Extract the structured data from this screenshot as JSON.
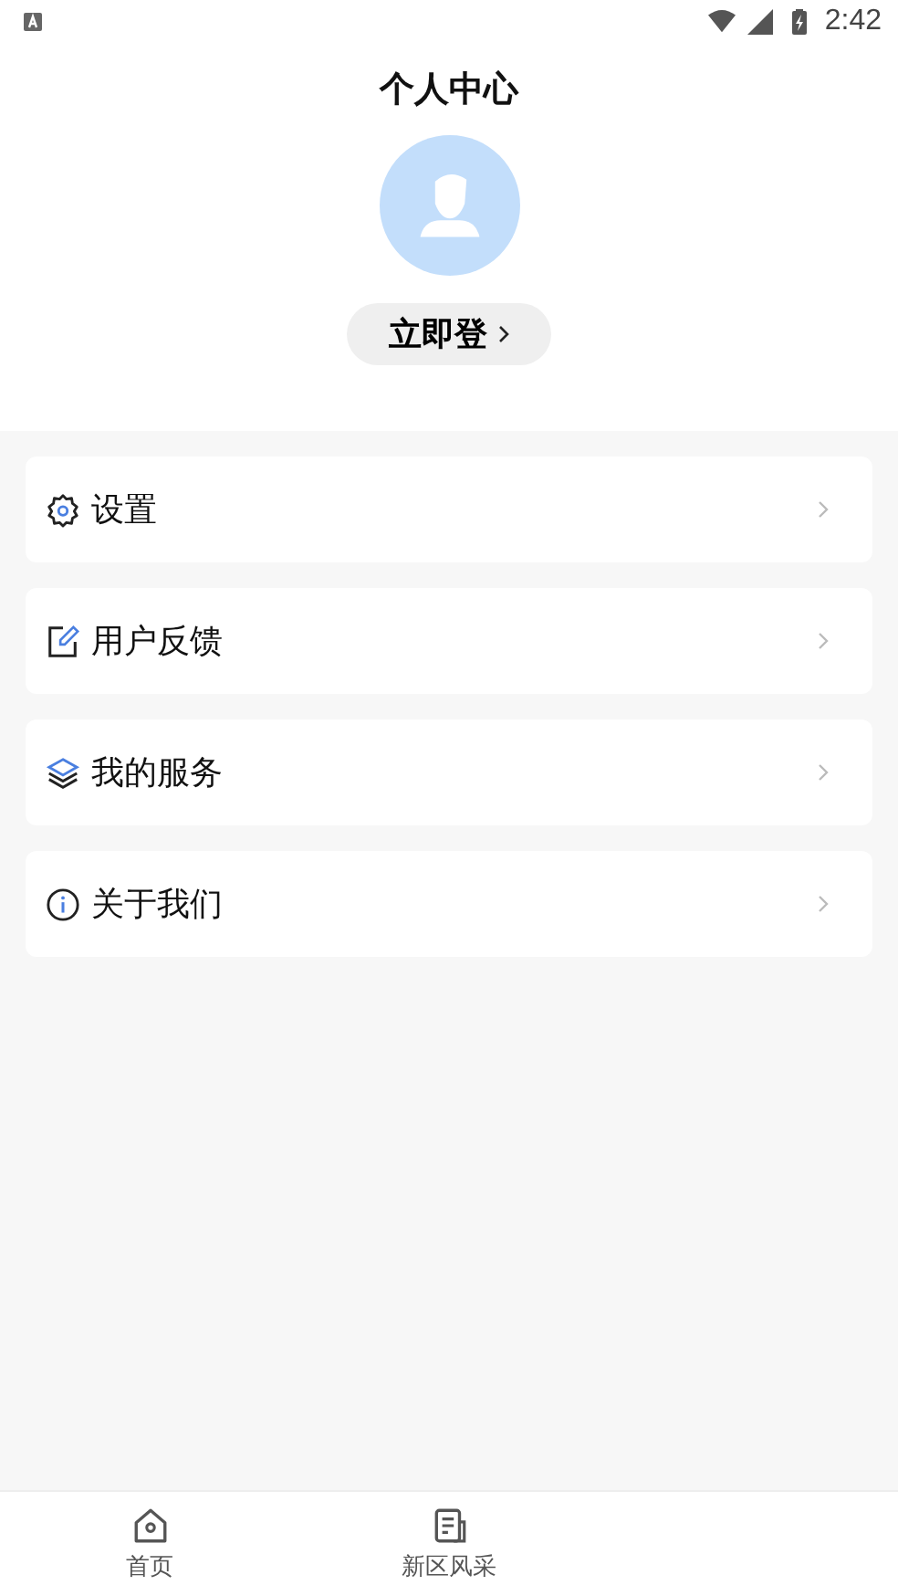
{
  "status_bar": {
    "time": "2:42"
  },
  "header": {
    "title": "个人中心",
    "login_button": "立即登"
  },
  "menu": [
    {
      "kind": "settings",
      "label": "设置"
    },
    {
      "kind": "feedback",
      "label": "用户反馈"
    },
    {
      "kind": "services",
      "label": "我的服务"
    },
    {
      "kind": "about",
      "label": "关于我们"
    }
  ],
  "tab_bar": [
    {
      "kind": "home",
      "label": "首页",
      "selected": false
    },
    {
      "kind": "news",
      "label": "新区风采",
      "selected": false
    }
  ]
}
